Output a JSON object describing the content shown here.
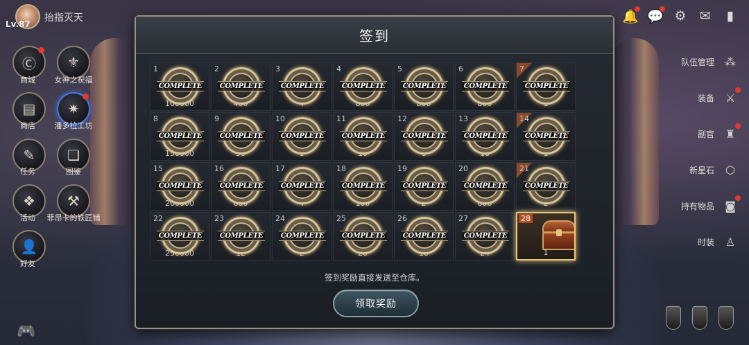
{
  "player": {
    "name": "抬指灭天",
    "level": "Lv.87"
  },
  "top_icons": [
    "bell-icon",
    "chat-icon",
    "gear-icon",
    "mail-icon",
    "signal-icon"
  ],
  "left_menu": [
    {
      "label": "商城",
      "icon": "shop-c-icon",
      "dot": true
    },
    {
      "label": "女神之祝福",
      "icon": "goddess-icon",
      "dot": false
    },
    {
      "label": "商店",
      "icon": "chest-icon",
      "dot": false
    },
    {
      "label": "潘多拉工坊",
      "icon": "workshop-icon",
      "dot": true
    },
    {
      "label": "任务",
      "icon": "scroll-icon",
      "dot": false
    },
    {
      "label": "图鉴",
      "icon": "book-icon",
      "dot": false
    },
    {
      "label": "活动",
      "icon": "gift-icon",
      "dot": false
    },
    {
      "label": "菲昂卡的铁匠铺",
      "icon": "anvil-icon",
      "dot": false
    },
    {
      "label": "好友",
      "icon": "friends-icon",
      "dot": false
    }
  ],
  "right_menu": [
    {
      "label": "队伍管理",
      "icon": "team-icon",
      "dot": false
    },
    {
      "label": "装备",
      "icon": "swords-icon",
      "dot": true
    },
    {
      "label": "副官",
      "icon": "helmet-icon",
      "dot": true
    },
    {
      "label": "新星石",
      "icon": "stone-icon",
      "dot": false
    },
    {
      "label": "持有物品",
      "icon": "bag-icon",
      "dot": true
    },
    {
      "label": "时装",
      "icon": "costume-icon",
      "dot": false
    }
  ],
  "modal": {
    "title": "签到",
    "badge_text": "COMPLETE",
    "notice": "签到奖励直接发送至仓库。",
    "claim_button": "领取奖励",
    "days": [
      {
        "day": "1",
        "qty": "100000",
        "weekly": false
      },
      {
        "day": "2",
        "qty": "400",
        "weekly": false
      },
      {
        "day": "3",
        "qty": "4",
        "weekly": false
      },
      {
        "day": "4",
        "qty": "800",
        "weekly": false
      },
      {
        "day": "5",
        "qty": "800",
        "weekly": false
      },
      {
        "day": "6",
        "qty": "800",
        "weekly": false
      },
      {
        "day": "7",
        "qty": "1",
        "weekly": true
      },
      {
        "day": "8",
        "qty": "150000",
        "weekly": false
      },
      {
        "day": "9",
        "qty": "50",
        "weekly": false
      },
      {
        "day": "10",
        "qty": "1",
        "weekly": false
      },
      {
        "day": "11",
        "qty": "10",
        "weekly": false
      },
      {
        "day": "12",
        "qty": "6",
        "weekly": false
      },
      {
        "day": "13",
        "qty": "16",
        "weekly": false
      },
      {
        "day": "14",
        "qty": "1",
        "weekly": true
      },
      {
        "day": "15",
        "qty": "200000",
        "weekly": false
      },
      {
        "day": "16",
        "qty": "800",
        "weekly": false
      },
      {
        "day": "17",
        "qty": "4",
        "weekly": false
      },
      {
        "day": "18",
        "qty": "100",
        "weekly": false
      },
      {
        "day": "19",
        "qty": "2",
        "weekly": false
      },
      {
        "day": "20",
        "qty": "600",
        "weekly": false
      },
      {
        "day": "21",
        "qty": "2",
        "weekly": true
      },
      {
        "day": "22",
        "qty": "250000",
        "weekly": false
      },
      {
        "day": "23",
        "qty": "12",
        "weekly": false
      },
      {
        "day": "24",
        "qty": "2",
        "weekly": false
      },
      {
        "day": "25",
        "qty": "20",
        "weekly": false
      },
      {
        "day": "26",
        "qty": "10",
        "weekly": false
      },
      {
        "day": "27",
        "qty": "24",
        "weekly": false
      },
      {
        "day": "28",
        "qty": "1",
        "weekly": false,
        "today": true
      }
    ]
  }
}
